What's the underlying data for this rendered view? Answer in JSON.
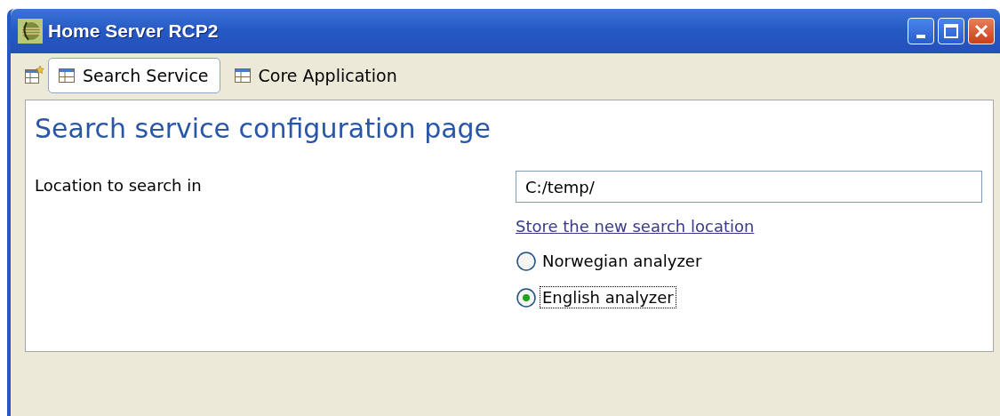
{
  "window": {
    "title": "Home Server RCP2"
  },
  "perspectives": [
    {
      "label": "Search Service",
      "selected": true
    },
    {
      "label": "Core Application",
      "selected": false
    }
  ],
  "page": {
    "heading": "Search service configuration page",
    "location_label": "Location to search in",
    "location_value": "C:/temp/",
    "store_link": "Store the new search location",
    "analyzers": [
      {
        "label": "Norwegian analyzer",
        "selected": false
      },
      {
        "label": "English analyzer",
        "selected": true
      }
    ]
  }
}
